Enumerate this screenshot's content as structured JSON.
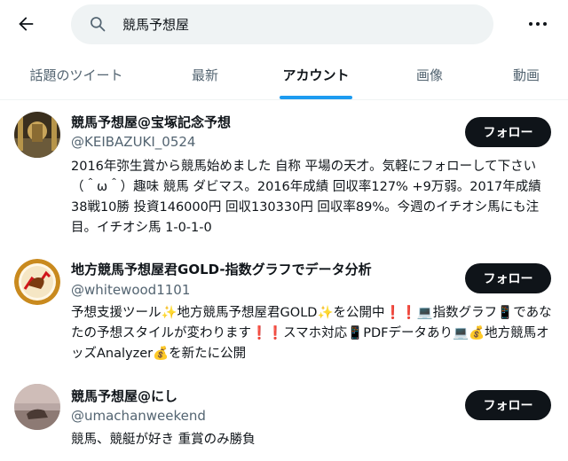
{
  "search": {
    "query": "競馬予想屋"
  },
  "tabs": [
    {
      "label": "話題のツイート"
    },
    {
      "label": "最新"
    },
    {
      "label": "アカウント"
    },
    {
      "label": "画像"
    },
    {
      "label": "動画"
    }
  ],
  "active_tab": "アカウント",
  "accent_color": "#1d9bf0",
  "users": [
    {
      "name": "競馬予想屋@宝塚記念予想",
      "handle": "@KEIBAZUKI_0524",
      "follow_label": "フォロー",
      "bio": "2016年弥生賞から競馬始めました 自称 平場の天才。気軽にフォローして下さい（＾ω＾）趣味 競馬 ダビマス。2016年成績 回収率127% +9万弱。2017年成績38戦10勝 投資146000円 回収130330円 回収率89%。今週のイチオシ馬にも注目。イチオシ馬 1-0-1-0"
    },
    {
      "name": "地方競馬予想屋君GOLD-指数グラフでデータ分析",
      "handle": "@whitewood1101",
      "follow_label": "フォロー",
      "bio": "予想支援ツール✨地方競馬予想屋君GOLD✨を公開中❗❗💻指数グラフ📱であなたの予想スタイルが変わります❗❗スマホ対応📱PDFデータあり💻💰地方競馬オッズAnalyzer💰を新たに公開"
    },
    {
      "name": "競馬予想屋@にし",
      "handle": "@umachanweekend",
      "follow_label": "フォロー",
      "bio": "競馬、競艇が好き 重賞のみ勝負"
    }
  ]
}
